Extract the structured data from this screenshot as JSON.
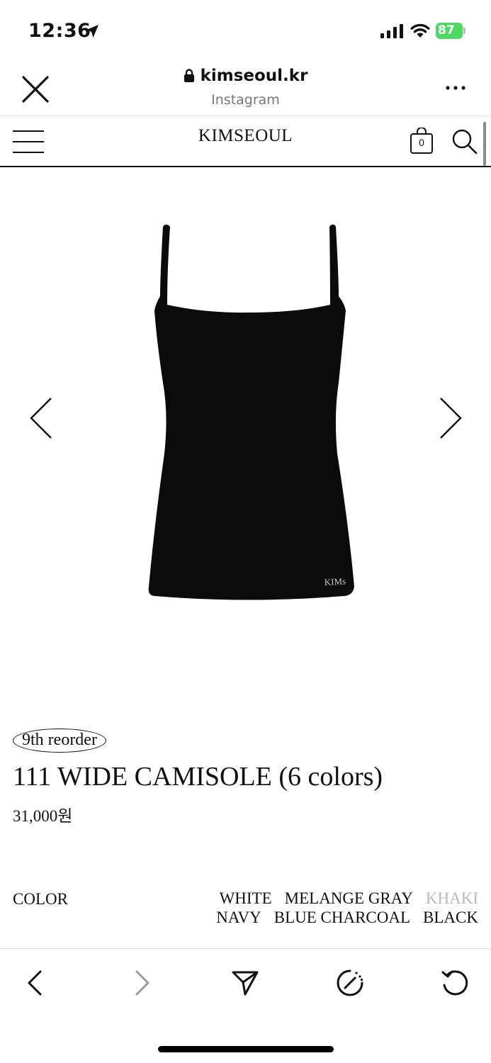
{
  "status_bar": {
    "time": "12:36",
    "battery": "87"
  },
  "browser": {
    "url": "kimseoul.kr",
    "source": "Instagram"
  },
  "site": {
    "logo": "KIMSEOUL",
    "cart_count": "0"
  },
  "product": {
    "image_logo_text": "KIMs",
    "badge": "9th reorder",
    "title": "111 WIDE CAMISOLE (6 colors)",
    "price": "31,000원",
    "color_label": "COLOR",
    "color_row1": [
      {
        "name": "WHITE",
        "available": true
      },
      {
        "name": "MELANGE GRAY",
        "available": true
      },
      {
        "name": "KHAKI",
        "available": false
      }
    ],
    "color_row2": [
      {
        "name": "NAVY",
        "available": true
      },
      {
        "name": "BLUE CHARCOAL",
        "available": true
      },
      {
        "name": "BLACK",
        "available": true
      }
    ]
  },
  "colors": {
    "battery": "#4cd964",
    "disabled_text": "#b9b9bd",
    "garment": "#0b0b0b"
  },
  "icons": [
    "location-arrow-icon",
    "signal-icon",
    "wifi-icon",
    "battery-icon",
    "close-icon",
    "lock-icon",
    "more-icon",
    "menu-icon",
    "cart-icon",
    "search-icon",
    "chevron-left-icon",
    "chevron-right-icon",
    "send-icon",
    "speed-icon",
    "reload-icon"
  ]
}
